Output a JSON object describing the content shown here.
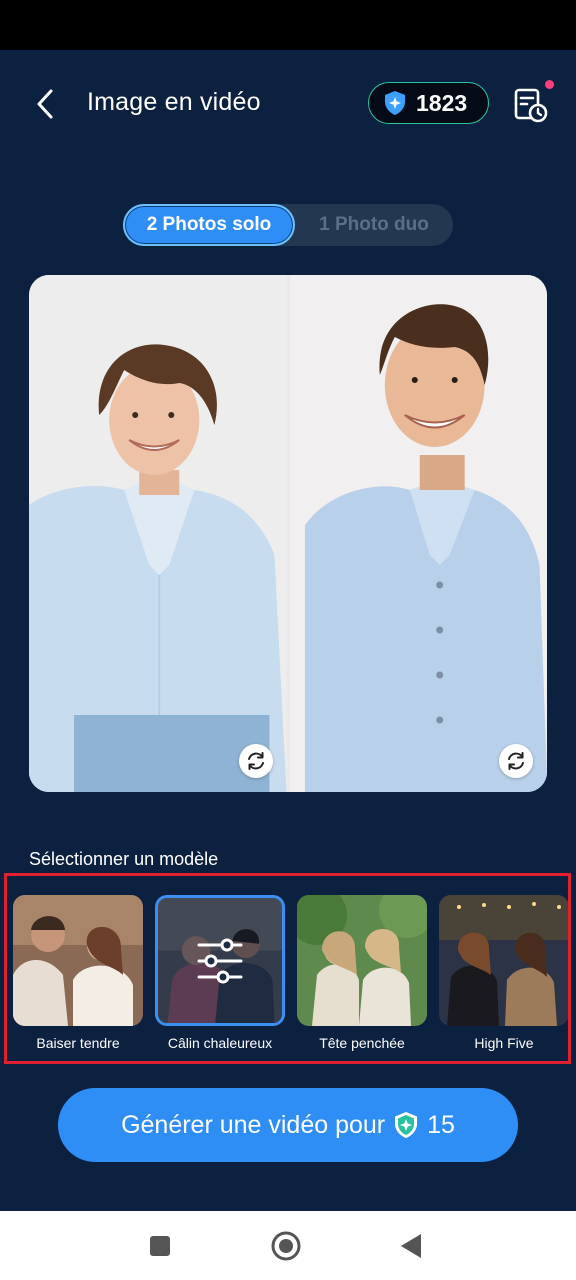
{
  "header": {
    "title": "Image en vidéo",
    "credits": "1823"
  },
  "mode_toggle": {
    "options": [
      "2 Photos solo",
      "1 Photo duo"
    ],
    "selected": "2 Photos solo"
  },
  "templates": {
    "section_label": "Sélectionner un modèle",
    "items": [
      {
        "label": "Baiser tendre",
        "selected": false
      },
      {
        "label": "Câlin chaleureux",
        "selected": true
      },
      {
        "label": "Tête penchée",
        "selected": false
      },
      {
        "label": "High Five",
        "selected": false
      }
    ]
  },
  "cta": {
    "label": "Générer une vidéo pour",
    "cost": "15"
  },
  "colors": {
    "background": "#0c2140",
    "accent": "#2f8ef5",
    "credit_badge_border": "#29c59a",
    "highlight_border": "#e0202e",
    "notification": "#ff3d7f"
  }
}
